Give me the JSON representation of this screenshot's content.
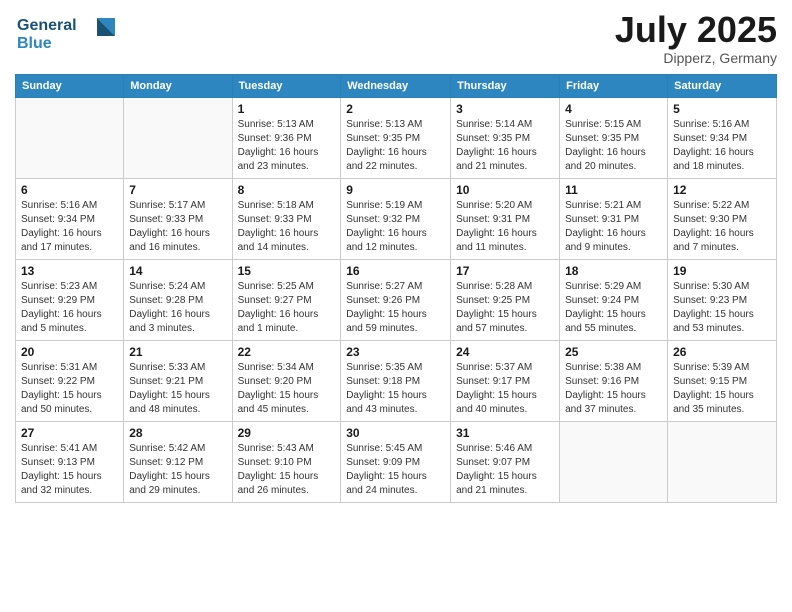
{
  "logo": {
    "line1": "General",
    "line2": "Blue"
  },
  "title": "July 2025",
  "location": "Dipperz, Germany",
  "days_of_week": [
    "Sunday",
    "Monday",
    "Tuesday",
    "Wednesday",
    "Thursday",
    "Friday",
    "Saturday"
  ],
  "weeks": [
    [
      {
        "day": "",
        "info": ""
      },
      {
        "day": "",
        "info": ""
      },
      {
        "day": "1",
        "info": "Sunrise: 5:13 AM\nSunset: 9:36 PM\nDaylight: 16 hours\nand 23 minutes."
      },
      {
        "day": "2",
        "info": "Sunrise: 5:13 AM\nSunset: 9:35 PM\nDaylight: 16 hours\nand 22 minutes."
      },
      {
        "day": "3",
        "info": "Sunrise: 5:14 AM\nSunset: 9:35 PM\nDaylight: 16 hours\nand 21 minutes."
      },
      {
        "day": "4",
        "info": "Sunrise: 5:15 AM\nSunset: 9:35 PM\nDaylight: 16 hours\nand 20 minutes."
      },
      {
        "day": "5",
        "info": "Sunrise: 5:16 AM\nSunset: 9:34 PM\nDaylight: 16 hours\nand 18 minutes."
      }
    ],
    [
      {
        "day": "6",
        "info": "Sunrise: 5:16 AM\nSunset: 9:34 PM\nDaylight: 16 hours\nand 17 minutes."
      },
      {
        "day": "7",
        "info": "Sunrise: 5:17 AM\nSunset: 9:33 PM\nDaylight: 16 hours\nand 16 minutes."
      },
      {
        "day": "8",
        "info": "Sunrise: 5:18 AM\nSunset: 9:33 PM\nDaylight: 16 hours\nand 14 minutes."
      },
      {
        "day": "9",
        "info": "Sunrise: 5:19 AM\nSunset: 9:32 PM\nDaylight: 16 hours\nand 12 minutes."
      },
      {
        "day": "10",
        "info": "Sunrise: 5:20 AM\nSunset: 9:31 PM\nDaylight: 16 hours\nand 11 minutes."
      },
      {
        "day": "11",
        "info": "Sunrise: 5:21 AM\nSunset: 9:31 PM\nDaylight: 16 hours\nand 9 minutes."
      },
      {
        "day": "12",
        "info": "Sunrise: 5:22 AM\nSunset: 9:30 PM\nDaylight: 16 hours\nand 7 minutes."
      }
    ],
    [
      {
        "day": "13",
        "info": "Sunrise: 5:23 AM\nSunset: 9:29 PM\nDaylight: 16 hours\nand 5 minutes."
      },
      {
        "day": "14",
        "info": "Sunrise: 5:24 AM\nSunset: 9:28 PM\nDaylight: 16 hours\nand 3 minutes."
      },
      {
        "day": "15",
        "info": "Sunrise: 5:25 AM\nSunset: 9:27 PM\nDaylight: 16 hours\nand 1 minute."
      },
      {
        "day": "16",
        "info": "Sunrise: 5:27 AM\nSunset: 9:26 PM\nDaylight: 15 hours\nand 59 minutes."
      },
      {
        "day": "17",
        "info": "Sunrise: 5:28 AM\nSunset: 9:25 PM\nDaylight: 15 hours\nand 57 minutes."
      },
      {
        "day": "18",
        "info": "Sunrise: 5:29 AM\nSunset: 9:24 PM\nDaylight: 15 hours\nand 55 minutes."
      },
      {
        "day": "19",
        "info": "Sunrise: 5:30 AM\nSunset: 9:23 PM\nDaylight: 15 hours\nand 53 minutes."
      }
    ],
    [
      {
        "day": "20",
        "info": "Sunrise: 5:31 AM\nSunset: 9:22 PM\nDaylight: 15 hours\nand 50 minutes."
      },
      {
        "day": "21",
        "info": "Sunrise: 5:33 AM\nSunset: 9:21 PM\nDaylight: 15 hours\nand 48 minutes."
      },
      {
        "day": "22",
        "info": "Sunrise: 5:34 AM\nSunset: 9:20 PM\nDaylight: 15 hours\nand 45 minutes."
      },
      {
        "day": "23",
        "info": "Sunrise: 5:35 AM\nSunset: 9:18 PM\nDaylight: 15 hours\nand 43 minutes."
      },
      {
        "day": "24",
        "info": "Sunrise: 5:37 AM\nSunset: 9:17 PM\nDaylight: 15 hours\nand 40 minutes."
      },
      {
        "day": "25",
        "info": "Sunrise: 5:38 AM\nSunset: 9:16 PM\nDaylight: 15 hours\nand 37 minutes."
      },
      {
        "day": "26",
        "info": "Sunrise: 5:39 AM\nSunset: 9:15 PM\nDaylight: 15 hours\nand 35 minutes."
      }
    ],
    [
      {
        "day": "27",
        "info": "Sunrise: 5:41 AM\nSunset: 9:13 PM\nDaylight: 15 hours\nand 32 minutes."
      },
      {
        "day": "28",
        "info": "Sunrise: 5:42 AM\nSunset: 9:12 PM\nDaylight: 15 hours\nand 29 minutes."
      },
      {
        "day": "29",
        "info": "Sunrise: 5:43 AM\nSunset: 9:10 PM\nDaylight: 15 hours\nand 26 minutes."
      },
      {
        "day": "30",
        "info": "Sunrise: 5:45 AM\nSunset: 9:09 PM\nDaylight: 15 hours\nand 24 minutes."
      },
      {
        "day": "31",
        "info": "Sunrise: 5:46 AM\nSunset: 9:07 PM\nDaylight: 15 hours\nand 21 minutes."
      },
      {
        "day": "",
        "info": ""
      },
      {
        "day": "",
        "info": ""
      }
    ]
  ]
}
